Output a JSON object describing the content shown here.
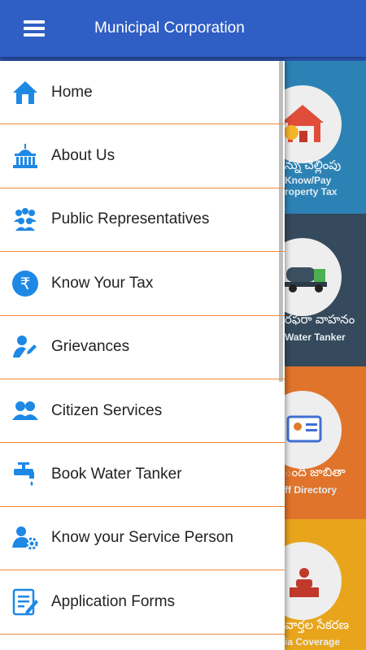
{
  "header": {
    "title": "Municipal Corporation"
  },
  "colors": {
    "primary": "#2f5ec4",
    "icon": "#1e88e5",
    "divider": "#f08a3c"
  },
  "drawer": {
    "items": [
      {
        "label": "Home",
        "icon": "home-icon"
      },
      {
        "label": "About Us",
        "icon": "building-icon"
      },
      {
        "label": "Public Representatives",
        "icon": "group-icon"
      },
      {
        "label": "Know Your Tax",
        "icon": "rupee-icon"
      },
      {
        "label": "Grievances",
        "icon": "user-edit-icon"
      },
      {
        "label": "Citizen Services",
        "icon": "people-icon"
      },
      {
        "label": "Book Water Tanker",
        "icon": "tap-icon"
      },
      {
        "label": "Know your Service Person",
        "icon": "user-gear-icon"
      },
      {
        "label": "Application Forms",
        "icon": "form-icon"
      }
    ]
  },
  "tiles": [
    {
      "native": "న్ను చెల్లింపు",
      "english": "Know/Pay",
      "english2": "roperty Tax"
    },
    {
      "native": "రఫరా వాహనం",
      "english": "Water Tanker"
    },
    {
      "native": "ంది జాబితా",
      "english": "ff Directory"
    },
    {
      "native": "వార్తల సేకరణ",
      "english": "ia Coverage"
    }
  ]
}
